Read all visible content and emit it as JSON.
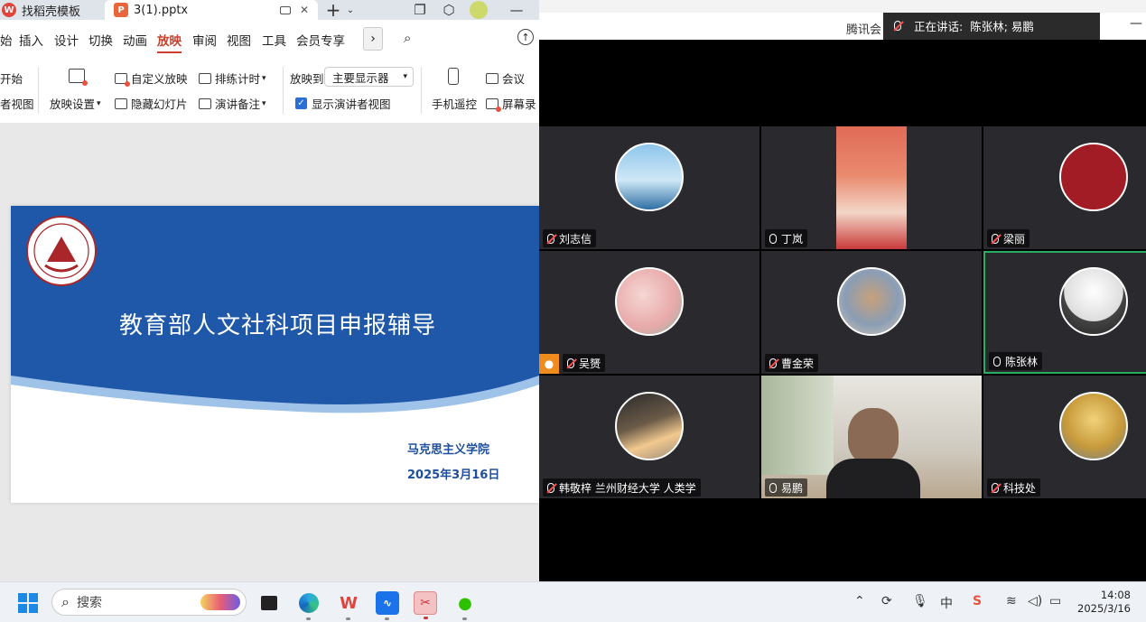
{
  "wps": {
    "tabs": {
      "template_label": "找稻壳模板",
      "file_label": "3(1).pptx"
    },
    "menu": [
      "始",
      "插入",
      "设计",
      "切换",
      "动画",
      "放映",
      "审阅",
      "视图",
      "工具",
      "会员专享"
    ],
    "ribbon": {
      "start_label": "开始",
      "presenter_view_label": "者视图",
      "show_settings": "放映设置",
      "custom_show": "自定义放映",
      "hide_slide": "隐藏幻灯片",
      "rehearse_timing": "排练计时",
      "speaker_notes": "演讲备注",
      "show_to_label": "放映到",
      "monitor_select": "主要显示器",
      "show_presenter_view": "显示演讲者视图",
      "phone_remote": "手机遥控",
      "meeting": "会议",
      "screen_record": "屏幕录"
    },
    "slide": {
      "title": "教育部人文社科项目申报辅导",
      "org": "马克思主义学院",
      "date": "2025年3月16日"
    }
  },
  "meeting": {
    "app_title": "腾讯会",
    "speaking_label": "正在讲话:",
    "speakers": "陈张林; 易鹏",
    "participants": [
      {
        "name": "刘志信",
        "mic": "off"
      },
      {
        "name": "丁岚",
        "mic": "on"
      },
      {
        "name": "梁丽",
        "mic": "off"
      },
      {
        "name": "吴赟",
        "mic": "off"
      },
      {
        "name": "曹金荣",
        "mic": "off"
      },
      {
        "name": "陈张林",
        "mic": "on"
      },
      {
        "name": "韩敬梓 兰州财经大学  人类学",
        "mic": "off"
      },
      {
        "name": "易鹏",
        "mic": "on"
      },
      {
        "name": "科技处",
        "mic": "off"
      }
    ]
  },
  "taskbar": {
    "search_placeholder": "搜索",
    "ime": "中",
    "time": "14:08",
    "date": "2025/3/16"
  },
  "colors": {
    "accent": "#c9412e",
    "slide_blue": "#1f4e9c",
    "active_speaker": "#27ae60"
  }
}
